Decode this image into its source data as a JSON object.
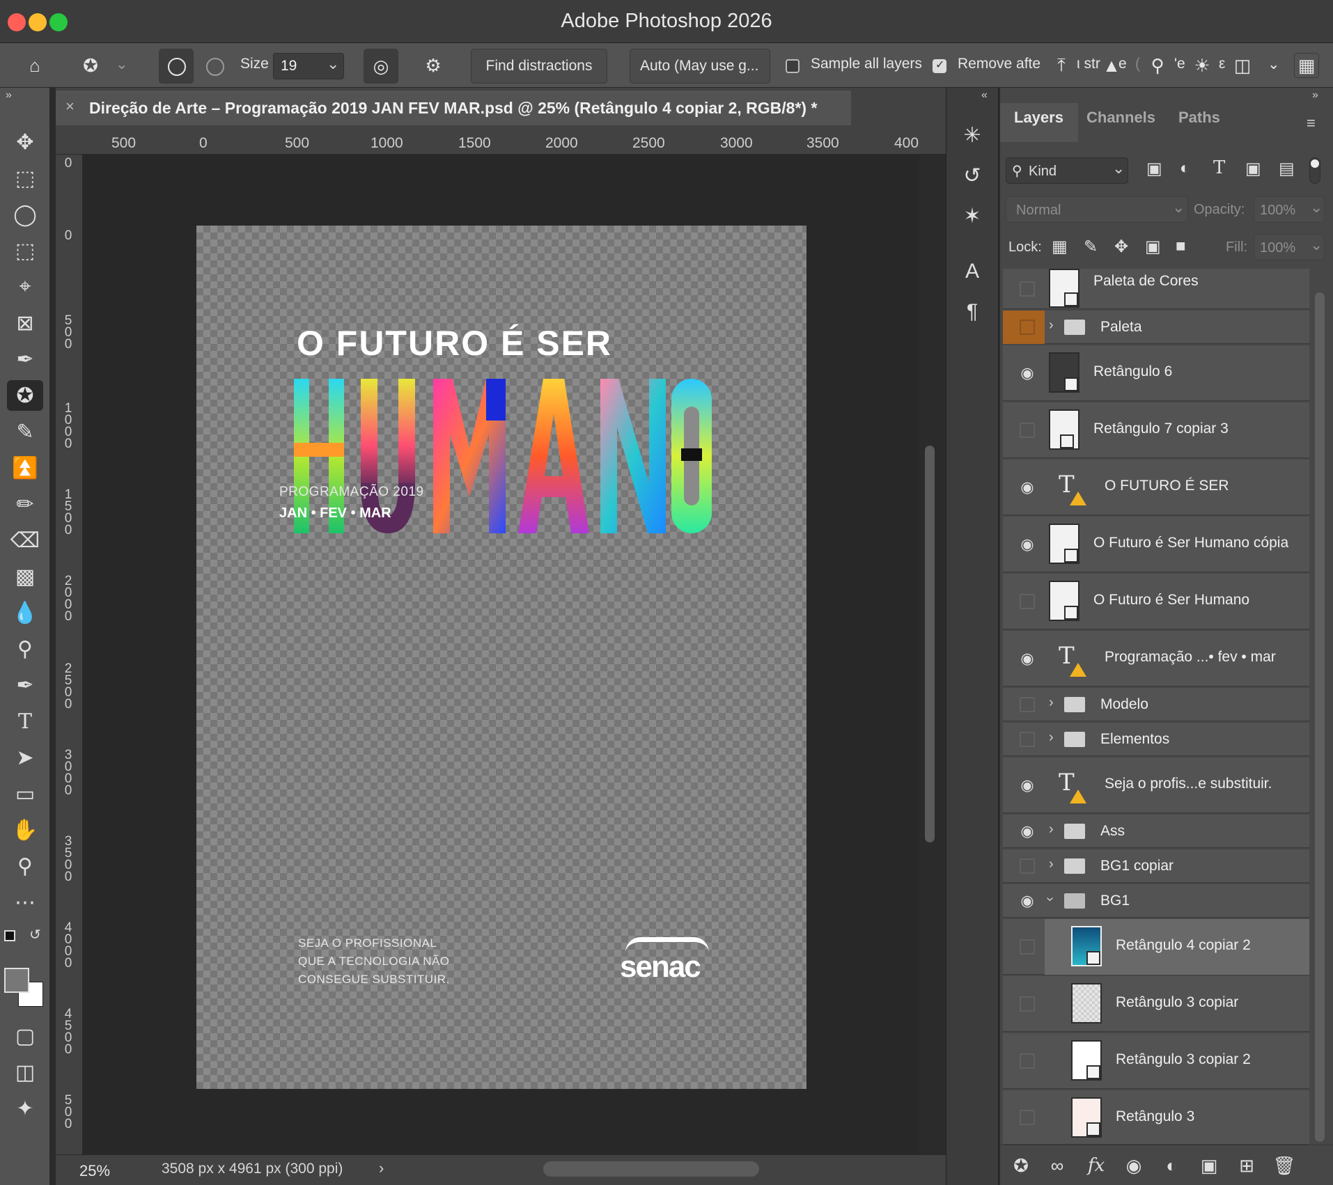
{
  "app": {
    "title": "Adobe Photoshop 2026"
  },
  "options": {
    "size_label": "Size",
    "size_value": "19",
    "find_distractions": "Find distractions",
    "mode": "Auto (May use g...",
    "sample_all_layers": "Sample all layers",
    "sample_all_checked": false,
    "remove_after": "Remove afte",
    "remove_after_checked": true,
    "truncated_1": "ι str",
    "truncated_2": "e",
    "truncated_3": "'e",
    "truncated_4": "ε"
  },
  "document": {
    "tab_title": "Direção de Arte – Programação 2019 JAN FEV MAR.psd @ 25% (Retângulo 4 copiar 2, RGB/8*) *",
    "zoom": "25%",
    "dimensions": "3508 px x 4961 px (300 ppi)"
  },
  "rulers": {
    "horizontal": [
      "500",
      "0",
      "500",
      "1000",
      "1500",
      "2000",
      "2500",
      "3000",
      "3500",
      "400"
    ],
    "vertical": [
      "0",
      "0",
      "500",
      "1000",
      "1500",
      "2000",
      "2500",
      "3000",
      "3500",
      "4000",
      "4500",
      "500"
    ]
  },
  "artwork": {
    "headline": "O FUTURO É SER",
    "big_word": [
      "H",
      "U",
      "M",
      "A",
      "N",
      "O"
    ],
    "subtitle": "PROGRAMAÇÃO 2019",
    "months": "JAN • FEV • MAR",
    "tagline": [
      "SEJA O PROFISSIONAL",
      "QUE A TECNOLOGIA NÃO",
      "CONSEGUE SUBSTITUIR."
    ],
    "logo": "senac"
  },
  "panel": {
    "tabs": [
      "Layers",
      "Channels",
      "Paths"
    ],
    "active_tab": "Layers",
    "filter_kind": "Kind",
    "blend_mode": "Normal",
    "opacity_label": "Opacity:",
    "opacity_value": "100%",
    "lock_label": "Lock:",
    "fill_label": "Fill:",
    "fill_value": "100%",
    "layers": [
      {
        "name": "Paleta de Cores",
        "type": "smart",
        "visible": false
      },
      {
        "name": "Paleta",
        "type": "group",
        "visible": false,
        "color": "#a7621f"
      },
      {
        "name": "Retângulo 6",
        "type": "smart",
        "visible": true
      },
      {
        "name": "Retângulo 7 copiar 3",
        "type": "shape",
        "visible": false
      },
      {
        "name": "O  FUTURO  É  SER",
        "type": "text",
        "visible": true
      },
      {
        "name": "O Futuro é Ser Humano cópia",
        "type": "smart",
        "visible": true
      },
      {
        "name": "O Futuro é Ser Humano",
        "type": "smart",
        "visible": false
      },
      {
        "name": "Programação ...• fev • mar",
        "type": "text",
        "visible": true
      },
      {
        "name": "Modelo",
        "type": "group",
        "visible": false
      },
      {
        "name": "Elementos",
        "type": "group",
        "visible": false
      },
      {
        "name": "Seja o profis...e substituir.",
        "type": "text",
        "visible": true
      },
      {
        "name": "Ass",
        "type": "group",
        "visible": true
      },
      {
        "name": "BG1 copiar",
        "type": "group",
        "visible": false
      },
      {
        "name": "BG1",
        "type": "group-open",
        "visible": true
      },
      {
        "name": "Retângulo 4 copiar 2",
        "type": "shape-child",
        "visible": false,
        "selected": true
      },
      {
        "name": "Retângulo 3 copiar",
        "type": "pattern-child",
        "visible": false
      },
      {
        "name": "Retângulo 3 copiar 2",
        "type": "shape-child",
        "visible": false
      },
      {
        "name": "Retângulo 3",
        "type": "shape-child",
        "visible": false
      }
    ]
  },
  "colors": {
    "accent_orange": "#a7621f",
    "canvas_bg": "#282828",
    "selected_row": "#696969"
  }
}
